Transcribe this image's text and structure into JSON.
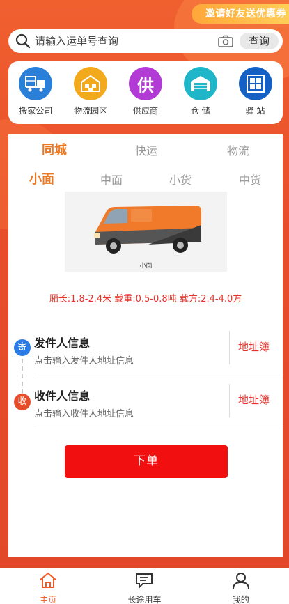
{
  "invite_banner": "邀请好友送优惠券",
  "search": {
    "placeholder": "请输入运单号查询",
    "button": "查询"
  },
  "services": [
    {
      "label": "搬家公司",
      "icon": "moving-truck-icon",
      "color": "#2a7fd9"
    },
    {
      "label": "物流园区",
      "icon": "warehouse-park-icon",
      "color": "#f3a91c"
    },
    {
      "label": "供应商",
      "icon": "supplier-icon",
      "color": "#b23bd6",
      "glyph": "供"
    },
    {
      "label": "仓 储",
      "icon": "storage-icon",
      "color": "#1fb6c9"
    },
    {
      "label": "驿 站",
      "icon": "station-icon",
      "color": "#1460c4"
    }
  ],
  "tabs_main": [
    "同城",
    "快运",
    "物流"
  ],
  "tabs_vehicle": [
    "小面",
    "中面",
    "小货",
    "中货"
  ],
  "vehicle": {
    "caption": "小面",
    "spec": "厢长:1.8-2.4米 载重:0.5-0.8吨 载方:2.4-4.0方"
  },
  "sender": {
    "badge": "寄",
    "title": "发件人信息",
    "hint": "点击输入发件人地址信息",
    "address_book": "地址簿"
  },
  "receiver": {
    "badge": "收",
    "title": "收件人信息",
    "hint": "点击输入收件人地址信息",
    "address_book": "地址簿"
  },
  "submit": "下单",
  "bottom_nav": [
    {
      "label": "主页",
      "icon": "home-icon"
    },
    {
      "label": "长途用车",
      "icon": "long-haul-message-icon"
    },
    {
      "label": "我的",
      "icon": "profile-icon"
    }
  ],
  "colors": {
    "accent": "#f07820",
    "red": "#f10f0f",
    "sender_badge": "#2c7be5",
    "receiver_badge": "#e84d2b"
  }
}
